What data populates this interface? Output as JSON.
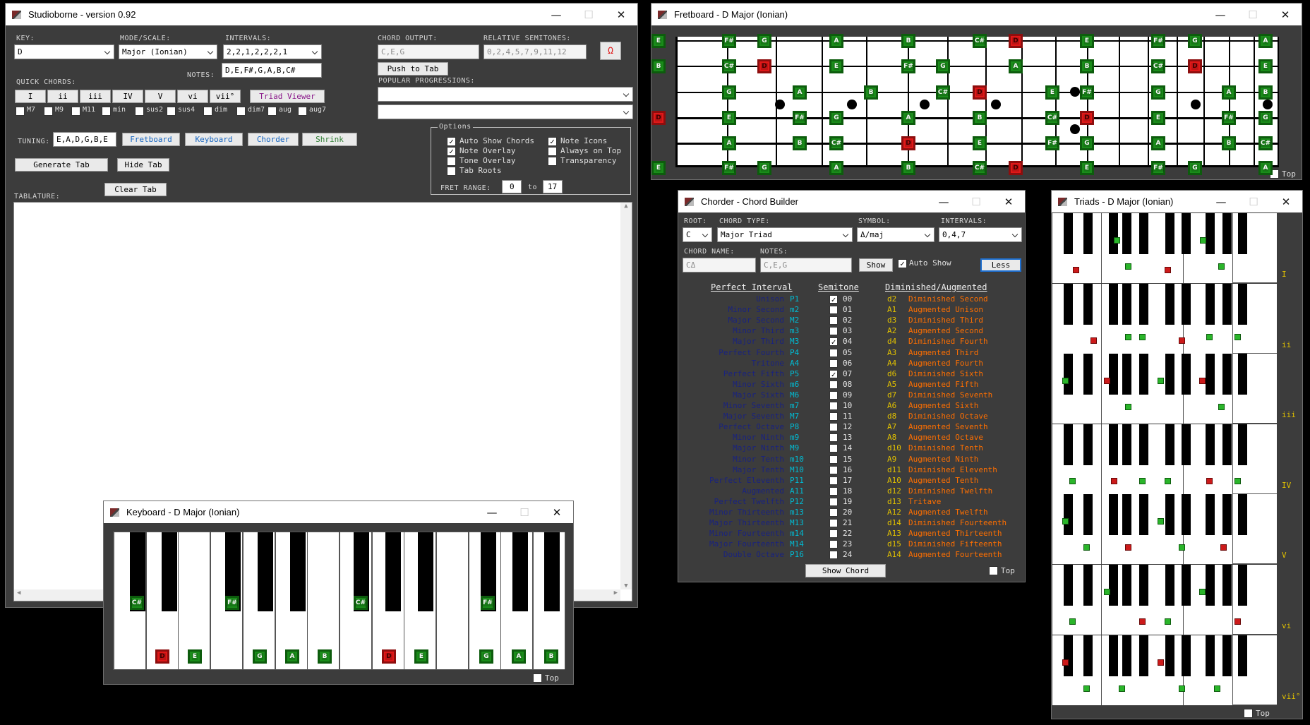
{
  "main": {
    "title": "Studioborne - version 0.92",
    "key_label": "KEY:",
    "key_value": "D",
    "mode_label": "MODE/SCALE:",
    "mode_value": "Major (Ionian)",
    "intervals_label": "INTERVALS:",
    "intervals_value": "2,2,1,2,2,2,1",
    "notes_label": "NOTES:",
    "notes_value": "D,E,F#,G,A,B,C#",
    "chord_output_label": "CHORD OUTPUT:",
    "chord_output_value": "C,E,G",
    "rel_semi_label": "RELATIVE SEMITONES:",
    "rel_semi_value": "0,2,4,5,7,9,11,12",
    "omega": "Ω",
    "push_to_tab": "Push to Tab",
    "popular_label": "POPULAR PROGRESSIONS:",
    "quick_label": "QUICK CHORDS:",
    "quick": [
      "I",
      "ii",
      "iii",
      "IV",
      "V",
      "vi",
      "vii°"
    ],
    "triad_viewer": "Triad Viewer",
    "mods": [
      "M7",
      "M9",
      "M11",
      "min",
      "sus2",
      "sus4",
      "dim",
      "dim7",
      "aug",
      "aug7"
    ],
    "tuning_label": "TUNING:",
    "tuning_value": "E,A,D,G,B,E",
    "fretboard_btn": "Fretboard",
    "keyboard_btn": "Keyboard",
    "chorder_btn": "Chorder",
    "shrink_btn": "Shrink",
    "generate_tab": "Generate Tab",
    "hide_tab": "Hide Tab",
    "clear_tab": "Clear Tab",
    "tablature_label": "TABLATURE:",
    "options_label": "Options",
    "opts": [
      {
        "label": "Auto Show Chords",
        "checked": true
      },
      {
        "label": "Note Icons",
        "checked": true
      },
      {
        "label": "Note Overlay",
        "checked": true
      },
      {
        "label": "Always on Top",
        "checked": false
      },
      {
        "label": "Tone Overlay",
        "checked": false
      },
      {
        "label": "Transparency",
        "checked": false
      },
      {
        "label": "Tab Roots",
        "checked": false
      }
    ],
    "fret_range_label": "FRET RANGE:",
    "fret_from": "0",
    "to_label": "to",
    "fret_to": "17"
  },
  "fretboard": {
    "title": "Fretboard - D Major (Ionian)",
    "top_label": "Top",
    "strings": [
      [
        [
          "E",
          "g"
        ],
        [
          "F#",
          "g"
        ],
        [
          "G",
          "g"
        ],
        [
          "A",
          "g"
        ],
        [
          "B",
          "g"
        ],
        [
          "C#",
          "g"
        ],
        [
          "D",
          "r"
        ],
        [
          "E",
          "g"
        ],
        [
          "F#",
          "g"
        ],
        [
          "G",
          "g"
        ],
        [
          "A",
          "g"
        ]
      ],
      [
        [
          "B",
          "g"
        ],
        [
          "C#",
          "g"
        ],
        [
          "D",
          "r"
        ],
        [
          "E",
          "g"
        ],
        [
          "F#",
          "g"
        ],
        [
          "G",
          "g"
        ],
        [
          "A",
          "g"
        ],
        [
          "B",
          "g"
        ],
        [
          "C#",
          "g"
        ],
        [
          "D",
          "r"
        ],
        [
          "E",
          "g"
        ]
      ],
      [
        [
          "G",
          "g"
        ],
        [
          "A",
          "g"
        ],
        [
          "B",
          "g"
        ],
        [
          "C#",
          "g"
        ],
        [
          "D",
          "r"
        ],
        [
          "E",
          "g"
        ],
        [
          "F#",
          "g"
        ],
        [
          "G",
          "g"
        ],
        [
          "A",
          "g"
        ],
        [
          "B",
          "g"
        ]
      ],
      [
        [
          "D",
          "r"
        ],
        [
          "E",
          "g"
        ],
        [
          "F#",
          "g"
        ],
        [
          "G",
          "g"
        ],
        [
          "A",
          "g"
        ],
        [
          "B",
          "g"
        ],
        [
          "C#",
          "g"
        ],
        [
          "D",
          "r"
        ],
        [
          "E",
          "g"
        ],
        [
          "F#",
          "g"
        ],
        [
          "G",
          "g"
        ]
      ],
      [
        [
          "A",
          "g"
        ],
        [
          "B",
          "g"
        ],
        [
          "C#",
          "g"
        ],
        [
          "D",
          "r"
        ],
        [
          "E",
          "g"
        ],
        [
          "F#",
          "g"
        ],
        [
          "G",
          "g"
        ],
        [
          "A",
          "g"
        ],
        [
          "B",
          "g"
        ],
        [
          "C#",
          "g"
        ],
        [
          "D",
          "r"
        ]
      ],
      [
        [
          "E",
          "g"
        ],
        [
          "F#",
          "g"
        ],
        [
          "G",
          "g"
        ],
        [
          "A",
          "g"
        ],
        [
          "B",
          "g"
        ],
        [
          "C#",
          "g"
        ],
        [
          "D",
          "r"
        ],
        [
          "E",
          "g"
        ],
        [
          "F#",
          "g"
        ],
        [
          "G",
          "g"
        ],
        [
          "A",
          "g"
        ]
      ]
    ]
  },
  "keyboard": {
    "title": "Keyboard - D Major (Ionian)",
    "top_label": "Top",
    "black_notes": [
      "C#",
      "F#",
      "C#",
      "F#"
    ],
    "white_notes": [
      [
        "D",
        "r"
      ],
      [
        "E",
        "g"
      ],
      [
        "G",
        "g"
      ],
      [
        "A",
        "g"
      ],
      [
        "B",
        "g"
      ],
      [
        "D",
        "r"
      ],
      [
        "E",
        "g"
      ],
      [
        "G",
        "g"
      ],
      [
        "A",
        "g"
      ],
      [
        "B",
        "g"
      ]
    ]
  },
  "chorder": {
    "title": "Chorder - Chord Builder",
    "root_label": "ROOT:",
    "root_value": "C",
    "type_label": "CHORD TYPE:",
    "type_value": "Major Triad",
    "symbol_label": "SYMBOL:",
    "symbol_value": "Δ/maj",
    "intervals_label": "INTERVALS:",
    "intervals_value": "0,4,7",
    "name_label": "CHORD NAME:",
    "name_value": "CΔ",
    "notes_label": "NOTES:",
    "notes_value": "C,E,G",
    "show": "Show",
    "auto_show": "Auto Show",
    "less": "Less",
    "h1": "Perfect Interval",
    "h2": "Semitone",
    "h3": "Diminished/Augmented",
    "rows": [
      [
        "Unison",
        "P1",
        "00",
        "d2",
        "Diminished Second",
        true
      ],
      [
        "Minor Second",
        "m2",
        "01",
        "A1",
        "Augmented Unison",
        false
      ],
      [
        "Major Second",
        "M2",
        "02",
        "d3",
        "Diminished Third",
        false
      ],
      [
        "Minor Third",
        "m3",
        "03",
        "A2",
        "Augmented Second",
        false
      ],
      [
        "Major Third",
        "M3",
        "04",
        "d4",
        "Diminished Fourth",
        true
      ],
      [
        "Perfect Fourth",
        "P4",
        "05",
        "A3",
        "Augmented Third",
        false
      ],
      [
        "Tritone",
        "A4",
        "06",
        "A4",
        "Augmented Fourth",
        false
      ],
      [
        "Perfect Fifth",
        "P5",
        "07",
        "d6",
        "Diminished Sixth",
        true
      ],
      [
        "Minor Sixth",
        "m6",
        "08",
        "A5",
        "Augmented Fifth",
        false
      ],
      [
        "Major Sixth",
        "M6",
        "09",
        "d7",
        "Diminished Seventh",
        false
      ],
      [
        "Minor Seventh",
        "m7",
        "10",
        "A6",
        "Augmented Sixth",
        false
      ],
      [
        "Major Seventh",
        "M7",
        "11",
        "d8",
        "Diminished Octave",
        false
      ],
      [
        "Perfect Octave",
        "P8",
        "12",
        "A7",
        "Augmented Seventh",
        false
      ],
      [
        "Minor Ninth",
        "m9",
        "13",
        "A8",
        "Augmented Octave",
        false
      ],
      [
        "Major Ninth",
        "M9",
        "14",
        "d10",
        "Diminished Tenth",
        false
      ],
      [
        "Minor Tenth",
        "m10",
        "15",
        "A9",
        "Augmented Ninth",
        false
      ],
      [
        "Major Tenth",
        "M10",
        "16",
        "d11",
        "Diminished Eleventh",
        false
      ],
      [
        "Perfect Eleventh",
        "P11",
        "17",
        "A10",
        "Augmented Tenth",
        false
      ],
      [
        "Augmented",
        "A11",
        "18",
        "d12",
        "Diminished Twelfth",
        false
      ],
      [
        "Perfect Twelfth",
        "P12",
        "19",
        "d13",
        "Tritave",
        false
      ],
      [
        "Minor Thirteenth",
        "m13",
        "20",
        "A12",
        "Augmented Twelfth",
        false
      ],
      [
        "Major Thirteenth",
        "M13",
        "21",
        "d14",
        "Diminished Fourteenth",
        false
      ],
      [
        "Minor Fourteenth",
        "m14",
        "22",
        "A13",
        "Augmented Thirteenth",
        false
      ],
      [
        "Major Fourteenth",
        "M14",
        "23",
        "d15",
        "Diminished Fifteenth",
        false
      ],
      [
        "Double Octave",
        "P16",
        "24",
        "A14",
        "Augmented Fourteenth",
        false
      ]
    ],
    "show_chord": "Show Chord",
    "top_label": "Top"
  },
  "triads": {
    "title": "Triads - D Major (Ionian)",
    "top_label": "Top",
    "labels": [
      "I",
      "ii",
      "iii",
      "IV",
      "V",
      "vi",
      "vii°"
    ]
  },
  "colors": {
    "panel": "#3c3c3c",
    "note_green": "#1a8c1a",
    "note_red": "#e01818",
    "interval_blue": "#1a237e",
    "interval_teal": "#00bcd4",
    "interval_yellow": "#e0c000",
    "interval_orange": "#ff6f00"
  }
}
